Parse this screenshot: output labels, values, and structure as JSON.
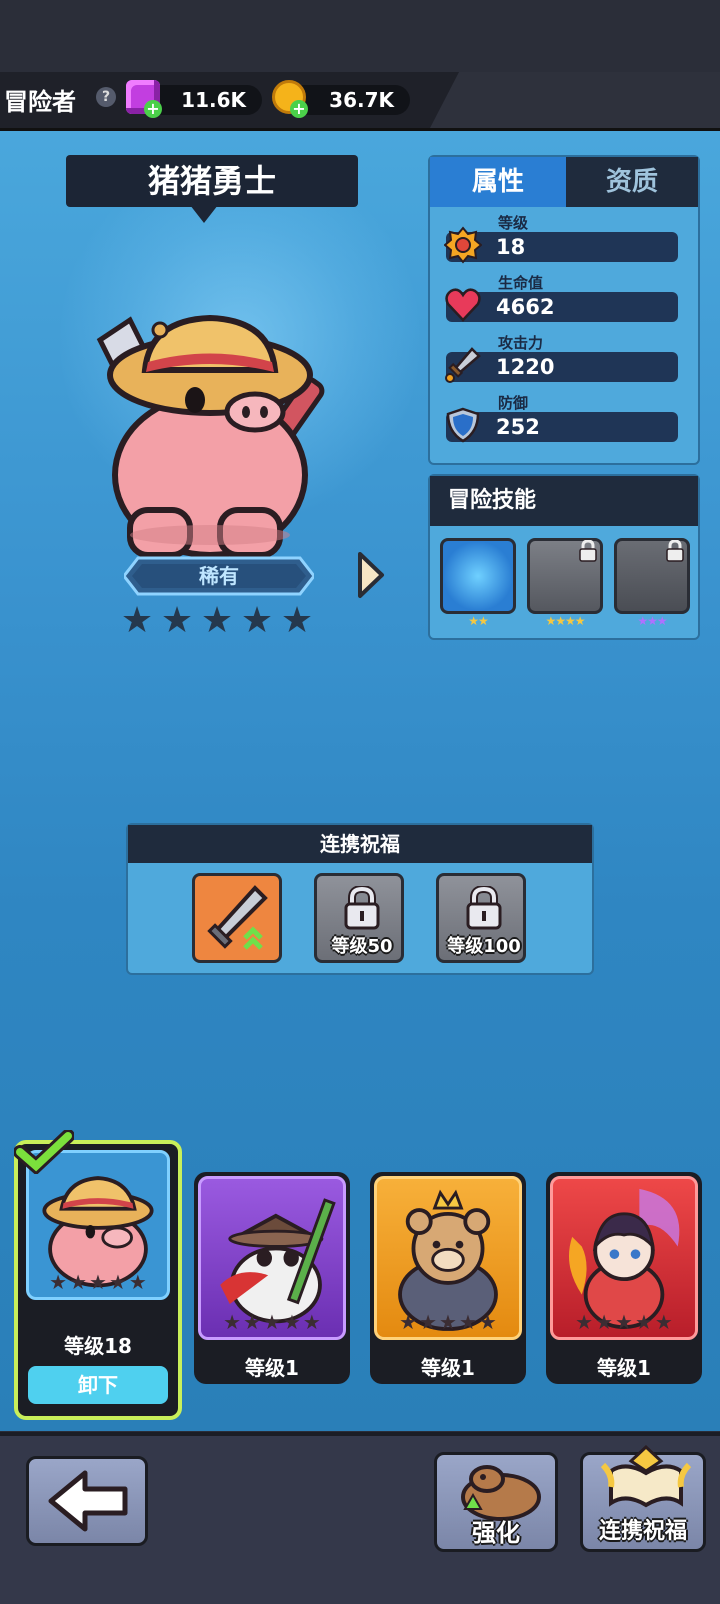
{
  "header": {
    "title": "冒险者",
    "gems": "11.6K",
    "gold": "36.7K"
  },
  "hero": {
    "name": "猪猪勇士",
    "rarity": "稀有",
    "stars_filled": 0,
    "stars_total": 5
  },
  "stats": {
    "tabs": [
      "属性",
      "资质"
    ],
    "active_tab": "属性",
    "items": [
      {
        "label": "等级",
        "value": "18",
        "icon": "level-badge-icon"
      },
      {
        "label": "生命值",
        "value": "4662",
        "icon": "heart-icon"
      },
      {
        "label": "攻击力",
        "value": "1220",
        "icon": "sword-icon"
      },
      {
        "label": "防御",
        "value": "252",
        "icon": "shield-icon"
      }
    ]
  },
  "skills": {
    "title": "冒险技能",
    "items": [
      {
        "icon": "bear-vortex-skill-icon",
        "stars": "★★",
        "locked": false,
        "star_color": "#f5c842"
      },
      {
        "icon": "bear-dash-skill-icon",
        "stars": "★★★★",
        "locked": true,
        "star_color": "#f5c842"
      },
      {
        "icon": "bear-box-skill-icon",
        "stars": "★★★",
        "locked": true,
        "star_color": "#b070ff"
      }
    ]
  },
  "blessing": {
    "title": "连携祝福",
    "slots": [
      {
        "icon": "sword-upgrade-icon",
        "locked": false,
        "label": ""
      },
      {
        "icon": "lock-icon",
        "locked": true,
        "label": "等级50"
      },
      {
        "icon": "lock-icon",
        "locked": true,
        "label": "等级100"
      }
    ]
  },
  "roster": [
    {
      "name": "pig-warrior",
      "level": "等级18",
      "selected": true,
      "action": "卸下",
      "frame": "#4aa7dc"
    },
    {
      "name": "panda-ninja",
      "level": "等级1",
      "selected": false,
      "frame": "#8a4ad6"
    },
    {
      "name": "bear-king",
      "level": "等级1",
      "selected": false,
      "frame": "#f0a020"
    },
    {
      "name": "dragon-girl",
      "level": "等级1",
      "selected": false,
      "frame": "#e03a3a"
    }
  ],
  "bottom": {
    "back_icon": "back-arrow-icon",
    "upgrade_label": "强化",
    "blessing_label": "连携祝福"
  }
}
